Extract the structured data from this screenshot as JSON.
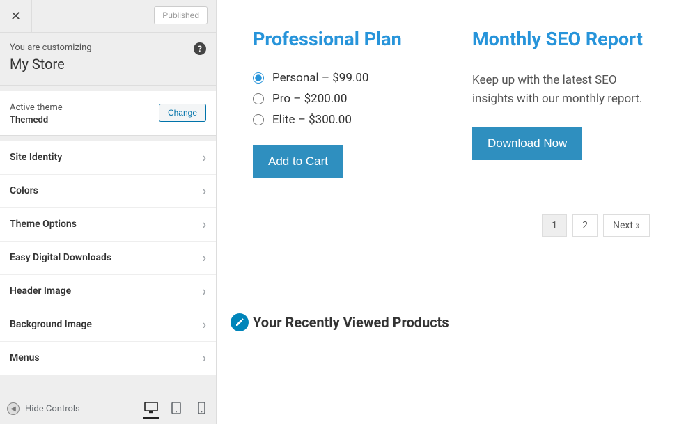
{
  "sidebar": {
    "published_label": "Published",
    "customizing_label": "You are customizing",
    "site_title": "My Store",
    "active_theme_label": "Active theme",
    "theme_name": "Themedd",
    "change_label": "Change",
    "menu_items": [
      {
        "label": "Site Identity"
      },
      {
        "label": "Colors"
      },
      {
        "label": "Theme Options"
      },
      {
        "label": "Easy Digital Downloads"
      },
      {
        "label": "Header Image"
      },
      {
        "label": "Background Image"
      },
      {
        "label": "Menus"
      }
    ],
    "hide_controls_label": "Hide Controls"
  },
  "preview": {
    "products": [
      {
        "title": "Professional Plan",
        "options": [
          {
            "label": "Personal – $99.00",
            "checked": true
          },
          {
            "label": "Pro – $200.00",
            "checked": false
          },
          {
            "label": "Elite – $300.00",
            "checked": false
          }
        ],
        "cta": "Add to Cart"
      },
      {
        "title": "Monthly SEO Report",
        "description": "Keep up with the latest SEO insights with our monthly report.",
        "cta": "Download Now"
      }
    ],
    "pagination": {
      "page1": "1",
      "page2": "2",
      "next": "Next »"
    },
    "recent_heading": "Your Recently Viewed Products"
  },
  "colors": {
    "accent": "#2794da",
    "button": "#2f8fbf",
    "wp_blue": "#0073aa"
  }
}
